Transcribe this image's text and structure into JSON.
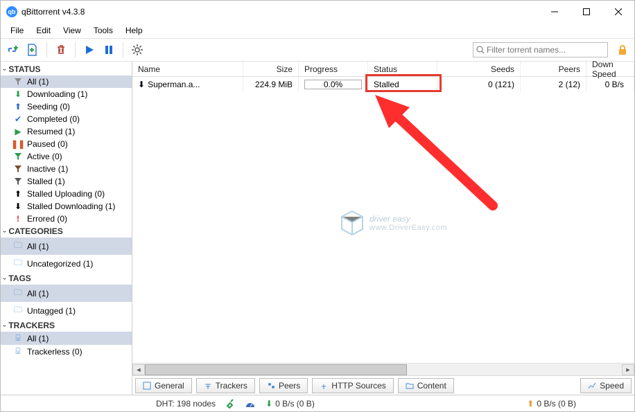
{
  "window": {
    "title": "qBittorrent v4.3.8"
  },
  "menu": {
    "file": "File",
    "edit": "Edit",
    "view": "View",
    "tools": "Tools",
    "help": "Help"
  },
  "search": {
    "placeholder": "Filter torrent names..."
  },
  "sidebar": {
    "status_hdr": "Status",
    "status": [
      {
        "label": "All (1)"
      },
      {
        "label": "Downloading (1)"
      },
      {
        "label": "Seeding (0)"
      },
      {
        "label": "Completed (0)"
      },
      {
        "label": "Resumed (1)"
      },
      {
        "label": "Paused (0)"
      },
      {
        "label": "Active (0)"
      },
      {
        "label": "Inactive (1)"
      },
      {
        "label": "Stalled (1)"
      },
      {
        "label": "Stalled Uploading (0)"
      },
      {
        "label": "Stalled Downloading (1)"
      },
      {
        "label": "Errored (0)"
      }
    ],
    "categories_hdr": "Categories",
    "categories": [
      {
        "label": "All (1)"
      },
      {
        "label": "Uncategorized (1)"
      }
    ],
    "tags_hdr": "Tags",
    "tags": [
      {
        "label": "All (1)"
      },
      {
        "label": "Untagged (1)"
      }
    ],
    "trackers_hdr": "Trackers",
    "trackers": [
      {
        "label": "All (1)"
      },
      {
        "label": "Trackerless (0)"
      }
    ]
  },
  "table": {
    "headers": {
      "name": "Name",
      "size": "Size",
      "progress": "Progress",
      "status": "Status",
      "seeds": "Seeds",
      "peers": "Peers",
      "down": "Down Speed"
    },
    "rows": [
      {
        "name": "Superman.a...",
        "size": "224.9 MiB",
        "progress": "0.0%",
        "status": "Stalled",
        "seeds": "0 (121)",
        "peers": "2 (12)",
        "down": "0 B/s"
      }
    ]
  },
  "tabs": {
    "general": "General",
    "trackers": "Trackers",
    "peers": "Peers",
    "http": "HTTP Sources",
    "content": "Content",
    "speed": "Speed"
  },
  "statusbar": {
    "dht": "DHT: 198 nodes",
    "down": "0 B/s (0 B)",
    "up": "0 B/s (0 B)"
  },
  "watermark": {
    "brand": "driver easy",
    "url": "www.DriverEasy.com"
  },
  "colors": {
    "highlight": "#e63b2e",
    "accent_arrow": "#ff2e2e"
  }
}
